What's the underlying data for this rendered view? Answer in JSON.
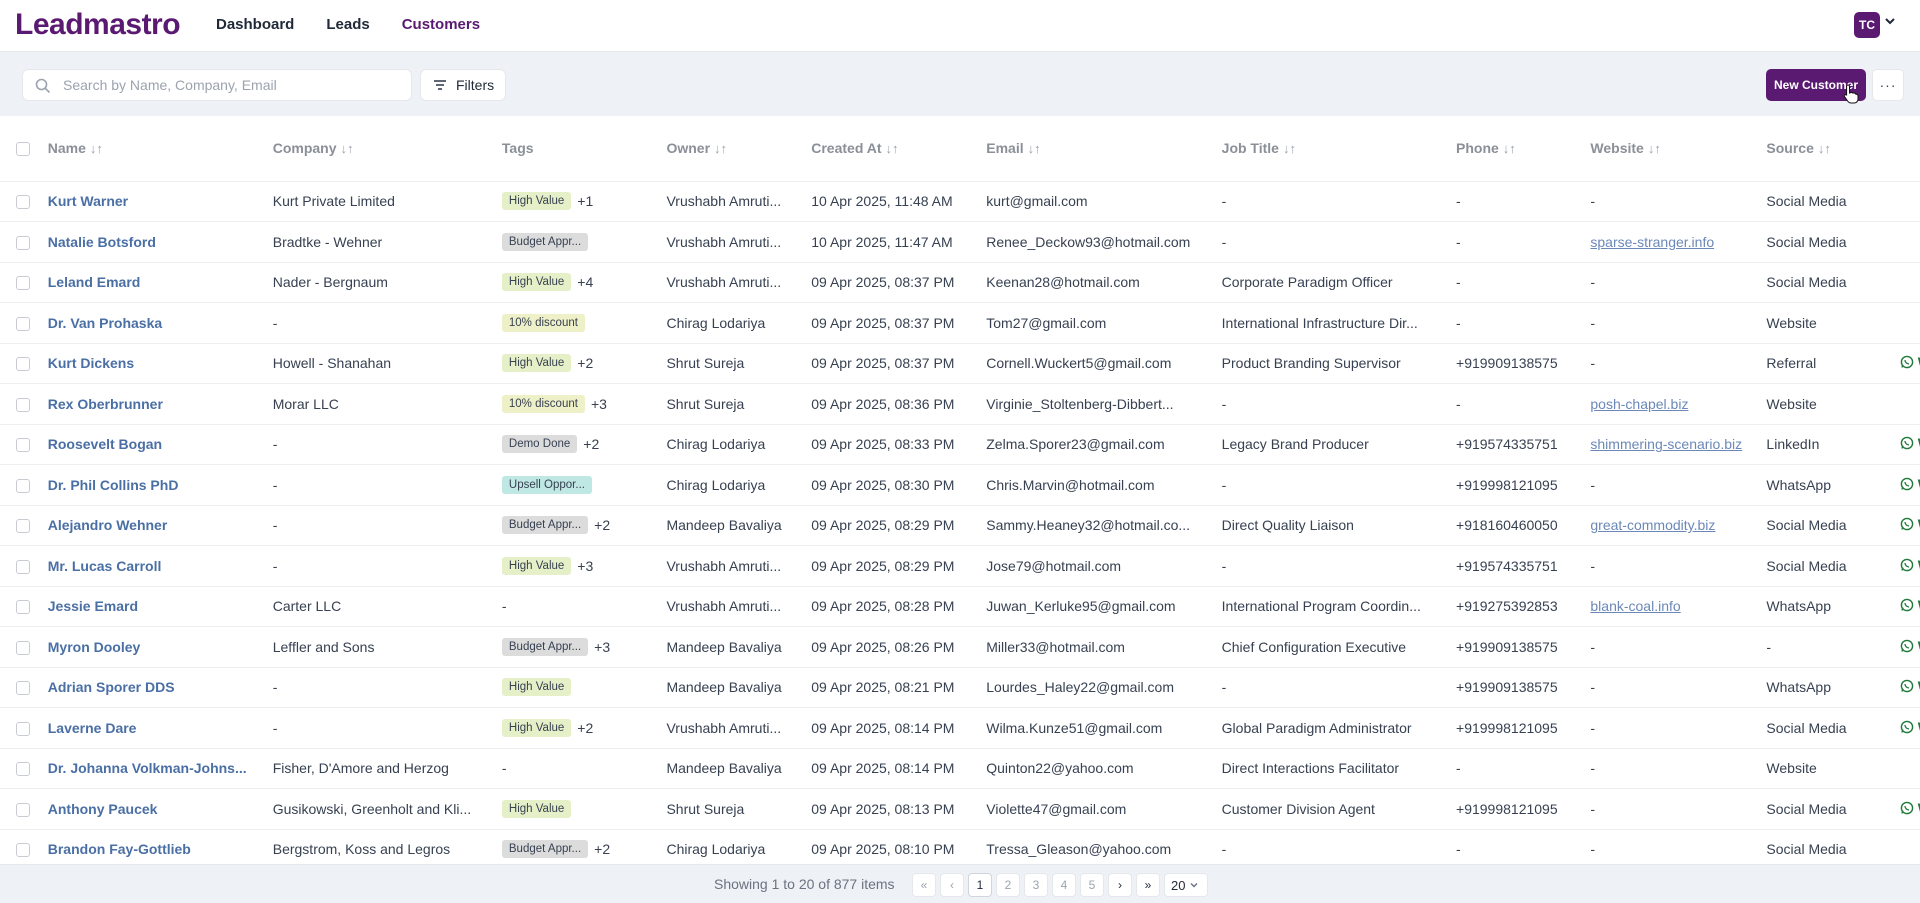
{
  "app": {
    "logo_text": "Leadmastro",
    "nav": [
      "Dashboard",
      "Leads",
      "Customers"
    ],
    "active_nav": "Customers",
    "user_initials": "TC",
    "brand_color": "#5b1a72"
  },
  "toolbar": {
    "search_placeholder": "Search by Name, Company, Email",
    "filters_label": "Filters",
    "new_customer_label": "New Customer",
    "more_label": "···"
  },
  "table": {
    "sort_icon": "↓↑",
    "columns": [
      "Name",
      "Company",
      "Tags",
      "Owner",
      "Created At",
      "Email",
      "Job Title",
      "Phone",
      "Website",
      "Source"
    ],
    "rows": [
      {
        "name": "Kurt Warner",
        "company": "Kurt Private Limited",
        "tag": "High Value",
        "tag_color": "#e6f0c8",
        "tag_more": "+1",
        "owner": "Vrushabh Amruti...",
        "created": "10 Apr 2025, 11:48 AM",
        "email": "kurt@gmail.com",
        "job": "-",
        "phone": "-",
        "website": "-",
        "website_link": false,
        "source": "Social Media",
        "wa": ""
      },
      {
        "name": "Natalie Botsford",
        "company": "Bradtke - Wehner",
        "tag": "Budget Appr...",
        "tag_color": "#dcdcdc",
        "tag_more": "",
        "owner": "Vrushabh Amruti...",
        "created": "10 Apr 2025, 11:47 AM",
        "email": "Renee_Deckow93@hotmail.com",
        "job": "-",
        "phone": "-",
        "website": "sparse-stranger.info",
        "website_link": true,
        "source": "Social Media",
        "wa": ""
      },
      {
        "name": "Leland Emard",
        "company": "Nader - Bergnaum",
        "tag": "High Value",
        "tag_color": "#e6f0c8",
        "tag_more": "+4",
        "owner": "Vrushabh Amruti...",
        "created": "09 Apr 2025, 08:37 PM",
        "email": "Keenan28@hotmail.com",
        "job": "Corporate Paradigm Officer",
        "phone": "-",
        "website": "-",
        "website_link": false,
        "source": "Social Media",
        "wa": ""
      },
      {
        "name": "Dr. Van Prohaska",
        "company": "-",
        "tag": "10% discount",
        "tag_color": "#eef0c8",
        "tag_more": "",
        "owner": "Chirag Lodariya",
        "created": "09 Apr 2025, 08:37 PM",
        "email": "Tom27@gmail.com",
        "job": "International Infrastructure Dir...",
        "phone": "-",
        "website": "-",
        "website_link": false,
        "source": "Website",
        "wa": ""
      },
      {
        "name": "Kurt Dickens",
        "company": "Howell - Shanahan",
        "tag": "High Value",
        "tag_color": "#e6f0c8",
        "tag_more": "+2",
        "owner": "Shrut Sureja",
        "created": "09 Apr 2025, 08:37 PM",
        "email": "Cornell.Wuckert5@gmail.com",
        "job": "Product Branding Supervisor",
        "phone": "+919909138575",
        "website": "-",
        "website_link": false,
        "source": "Referral",
        "wa": "Wha"
      },
      {
        "name": "Rex Oberbrunner",
        "company": "Morar LLC",
        "tag": "10% discount",
        "tag_color": "#eef0c8",
        "tag_more": "+3",
        "owner": "Shrut Sureja",
        "created": "09 Apr 2025, 08:36 PM",
        "email": "Virginie_Stoltenberg-Dibbert...",
        "job": "-",
        "phone": "-",
        "website": "posh-chapel.biz",
        "website_link": true,
        "source": "Website",
        "wa": ""
      },
      {
        "name": "Roosevelt Bogan",
        "company": "-",
        "tag": "Demo Done",
        "tag_color": "#dcdcdc",
        "tag_more": "+2",
        "owner": "Chirag Lodariya",
        "created": "09 Apr 2025, 08:33 PM",
        "email": "Zelma.Sporer23@gmail.com",
        "job": "Legacy Brand Producer",
        "phone": "+919574335751",
        "website": "shimmering-scenario.biz",
        "website_link": true,
        "source": "LinkedIn",
        "wa": "Wha"
      },
      {
        "name": "Dr. Phil Collins PhD",
        "company": "-",
        "tag": "Upsell Oppor...",
        "tag_color": "#bfe7e3",
        "tag_more": "",
        "owner": "Chirag Lodariya",
        "created": "09 Apr 2025, 08:30 PM",
        "email": "Chris.Marvin@hotmail.com",
        "job": "-",
        "phone": "+919998121095",
        "website": "-",
        "website_link": false,
        "source": "WhatsApp",
        "wa": "Wha"
      },
      {
        "name": "Alejandro Wehner",
        "company": "-",
        "tag": "Budget Appr...",
        "tag_color": "#dcdcdc",
        "tag_more": "+2",
        "owner": "Mandeep Bavaliya",
        "created": "09 Apr 2025, 08:29 PM",
        "email": "Sammy.Heaney32@hotmail.co...",
        "job": "Direct Quality Liaison",
        "phone": "+918160460050",
        "website": "great-commodity.biz",
        "website_link": true,
        "source": "Social Media",
        "wa": "Wha"
      },
      {
        "name": "Mr. Lucas Carroll",
        "company": "-",
        "tag": "High Value",
        "tag_color": "#e6f0c8",
        "tag_more": "+3",
        "owner": "Vrushabh Amruti...",
        "created": "09 Apr 2025, 08:29 PM",
        "email": "Jose79@hotmail.com",
        "job": "-",
        "phone": "+919574335751",
        "website": "-",
        "website_link": false,
        "source": "Social Media",
        "wa": "Wha"
      },
      {
        "name": "Jessie Emard",
        "company": "Carter LLC",
        "tag": "",
        "tag_color": "",
        "tag_more": "",
        "tag_dash": "-",
        "owner": "Vrushabh Amruti...",
        "created": "09 Apr 2025, 08:28 PM",
        "email": "Juwan_Kerluke95@gmail.com",
        "job": "International Program Coordin...",
        "phone": "+919275392853",
        "website": "blank-coal.info",
        "website_link": true,
        "source": "WhatsApp",
        "wa": "Wha"
      },
      {
        "name": "Myron Dooley",
        "company": "Leffler and Sons",
        "tag": "Budget Appr...",
        "tag_color": "#dcdcdc",
        "tag_more": "+3",
        "owner": "Mandeep Bavaliya",
        "created": "09 Apr 2025, 08:26 PM",
        "email": "Miller33@hotmail.com",
        "job": "Chief Configuration Executive",
        "phone": "+919909138575",
        "website": "-",
        "website_link": false,
        "source": "-",
        "wa": "Wha"
      },
      {
        "name": "Adrian Sporer DDS",
        "company": "-",
        "tag": "High Value",
        "tag_color": "#e6f0c8",
        "tag_more": "",
        "owner": "Mandeep Bavaliya",
        "created": "09 Apr 2025, 08:21 PM",
        "email": "Lourdes_Haley22@gmail.com",
        "job": "-",
        "phone": "+919909138575",
        "website": "-",
        "website_link": false,
        "source": "WhatsApp",
        "wa": "Wha"
      },
      {
        "name": "Laverne Dare",
        "company": "-",
        "tag": "High Value",
        "tag_color": "#e6f0c8",
        "tag_more": "+2",
        "owner": "Vrushabh Amruti...",
        "created": "09 Apr 2025, 08:14 PM",
        "email": "Wilma.Kunze51@gmail.com",
        "job": "Global Paradigm Administrator",
        "phone": "+919998121095",
        "website": "-",
        "website_link": false,
        "source": "Social Media",
        "wa": "Wha"
      },
      {
        "name": "Dr. Johanna Volkman-Johns...",
        "company": "Fisher, D'Amore and Herzog",
        "tag": "",
        "tag_color": "",
        "tag_more": "",
        "tag_dash": "-",
        "owner": "Mandeep Bavaliya",
        "created": "09 Apr 2025, 08:14 PM",
        "email": "Quinton22@yahoo.com",
        "job": "Direct Interactions Facilitator",
        "phone": "-",
        "website": "-",
        "website_link": false,
        "source": "Website",
        "wa": ""
      },
      {
        "name": "Anthony Paucek",
        "company": "Gusikowski, Greenholt and Kli...",
        "tag": "High Value",
        "tag_color": "#e6f0c8",
        "tag_more": "",
        "owner": "Shrut Sureja",
        "created": "09 Apr 2025, 08:13 PM",
        "email": "Violette47@gmail.com",
        "job": "Customer Division Agent",
        "phone": "+919998121095",
        "website": "-",
        "website_link": false,
        "source": "Social Media",
        "wa": "Wha"
      },
      {
        "name": "Brandon Fay-Gottlieb",
        "company": "Bergstrom, Koss and Legros",
        "tag": "Budget Appr...",
        "tag_color": "#dcdcdc",
        "tag_more": "+2",
        "owner": "Chirag Lodariya",
        "created": "09 Apr 2025, 08:10 PM",
        "email": "Tressa_Gleason@yahoo.com",
        "job": "-",
        "phone": "-",
        "website": "-",
        "website_link": false,
        "source": "Social Media",
        "wa": ""
      }
    ]
  },
  "pagination": {
    "info": "Showing 1 to 20 of 877 items",
    "pages": [
      "1",
      "2",
      "3",
      "4",
      "5"
    ],
    "current_page": "1",
    "page_size": "20",
    "first": "«",
    "prev": "‹",
    "next": "›",
    "last": "»"
  }
}
